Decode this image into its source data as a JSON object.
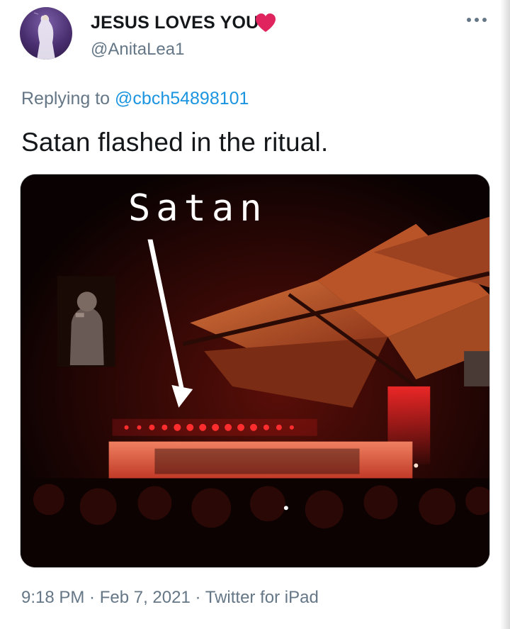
{
  "tweet": {
    "display_name": "JESUS LOVES YOU",
    "handle": "@AnitaLea1",
    "reply_prefix": "Replying to ",
    "reply_mention": "@cbch54898101",
    "text": "Satan flashed in the ritual.",
    "media": {
      "overlay_label": "Satan"
    },
    "time": "9:18 PM",
    "separator": " · ",
    "date": "Feb 7, 2021",
    "source": "Twitter for iPad"
  },
  "icons": {
    "heart": "red-heart-icon",
    "more": "more-options-icon"
  },
  "colors": {
    "text_primary": "#14171a",
    "text_secondary": "#657786",
    "mention": "#1b95e0",
    "heart": "#e0245e"
  }
}
